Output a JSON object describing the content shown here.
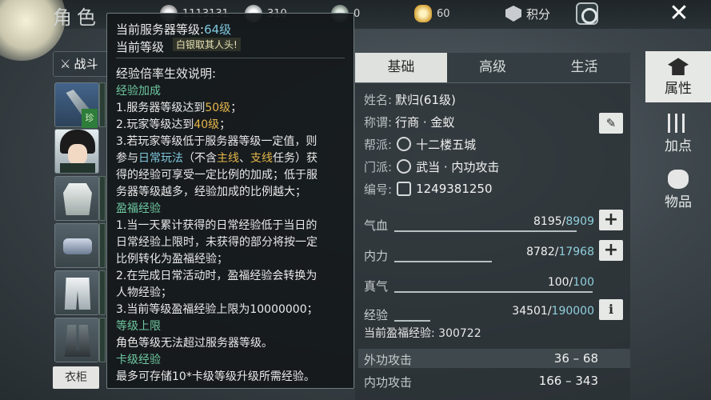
{
  "header": {
    "title": "角色",
    "resources": [
      {
        "icon": "silver-coin-icon",
        "value": "1113131"
      },
      {
        "icon": "silver-ingot-icon",
        "value": "310"
      },
      {
        "icon": "jade-coin-icon",
        "value": "0"
      },
      {
        "icon": "gold-ingot-icon",
        "value": "60"
      }
    ],
    "score_label": "积分"
  },
  "left": {
    "battle_tab": "战斗",
    "tag": "珍",
    "wardrobe": "衣柜"
  },
  "tabs": [
    "基础",
    "高级",
    "生活"
  ],
  "profile": {
    "name_k": "姓名:",
    "name_v": "默归(61级)",
    "title_k": "称谓:",
    "title_v": "行商 · 金蚁",
    "guild_k": "帮派:",
    "guild_v": "十二楼五城",
    "sect_k": "门派:",
    "sect_v": "武当 · 内功攻击",
    "id_k": "编号:",
    "id_v": "1249381250"
  },
  "stats": [
    {
      "label": "气血",
      "cur": "8195",
      "max": "8909",
      "ratio": 0.92
    },
    {
      "label": "内力",
      "cur": "8782",
      "max": "17968",
      "ratio": 0.49
    },
    {
      "label": "真气",
      "cur": "100",
      "max": "100",
      "ratio": 1.0
    },
    {
      "label": "经验",
      "cur": "34501",
      "max": "190000",
      "ratio": 0.18
    }
  ],
  "surplus_exp": "当前盈福经验: 300722",
  "attacks": [
    {
      "label": "外功攻击",
      "value": "36 – 68"
    },
    {
      "label": "内功攻击",
      "value": "166 – 343"
    }
  ],
  "sidenav": [
    "属性",
    "加点",
    "物品"
  ],
  "tooltip": {
    "server_level_label": "当前服务器等级:",
    "server_level": "64级",
    "player_level_label": "当前等级",
    "banner": "白银取其人头!",
    "heading": "经验倍率生效说明:",
    "sections": [
      {
        "title": "经验加成"
      },
      {
        "title": "盈福经验"
      },
      {
        "title": "等级上限"
      },
      {
        "title": "卡级经验"
      }
    ],
    "l1": "1.服务器等级达到",
    "l1_hl": "50级",
    "l2": "2.玩家等级达到",
    "l2_hl": "40级",
    "l3": "3.若玩家等级低于服务器等级一定值，则",
    "l4a": "参与",
    "l4_daily": "日常玩法",
    "l4b": "（不含",
    "l4_main": "主线",
    "l4_sep": "、",
    "l4_branch": "支线",
    "l4c": "任务）获",
    "l5": "得的经验可享受一定比例的加成；低于服",
    "l6": "务器等级越多，经验加成的比例越大；",
    "m1": "1.当一天累计获得的日常经验低于当日的",
    "m2": "日常经验上限时，未获得的部分将按一定",
    "m3": "比例转化为盈福经验；",
    "m4": "2.在完成日常活动时，盈福经验会转换为",
    "m5": "人物经验；",
    "m6": "3.当前等级盈福经验上限为10000000；",
    "c1": "角色等级无法超过服务器等级。",
    "k1": "最多可存储10*卡级等级升级所需经验。"
  }
}
